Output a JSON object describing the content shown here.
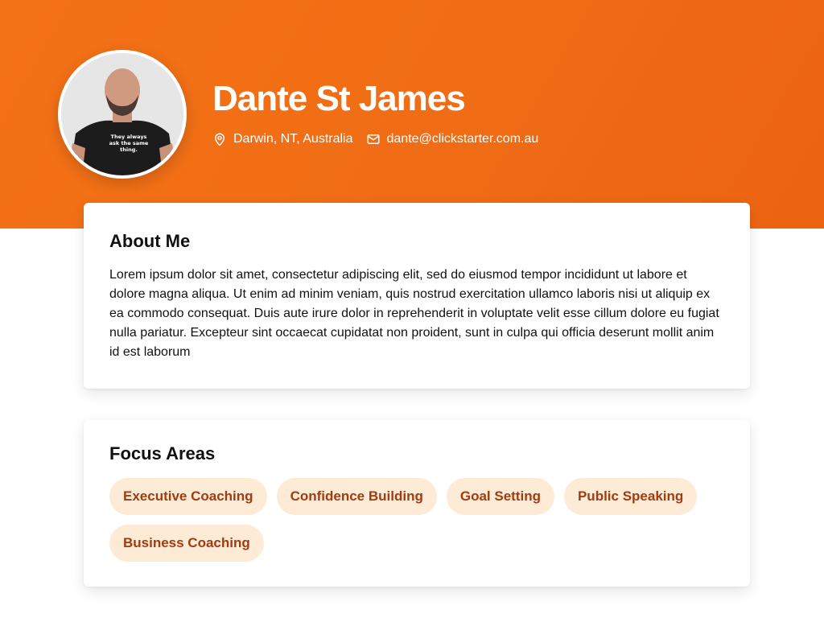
{
  "profile": {
    "name": "Dante St James",
    "location": "Darwin, NT, Australia",
    "email": "dante@clickstarter.com.au",
    "avatar_shirt_text": "They always ask the same thing.",
    "avatar_icon": "profile-photo"
  },
  "icons": {
    "location": "map-pin-icon",
    "email": "envelope-icon"
  },
  "about": {
    "title": "About Me",
    "text": "Lorem ipsum dolor sit amet, consectetur adipiscing elit, sed do eiusmod tempor incididunt ut labore et dolore magna aliqua. Ut enim ad minim veniam, quis nostrud exercitation ullamco laboris nisi ut aliquip ex ea commodo consequat. Duis aute irure dolor in reprehenderit in voluptate velit esse cillum dolore eu fugiat nulla pariatur. Excepteur sint occaecat cupidatat non proident, sunt in culpa qui officia deserunt mollit anim id est laborum"
  },
  "focus": {
    "title": "Focus Areas",
    "tags": [
      "Executive Coaching",
      "Confidence Building",
      "Goal Setting",
      "Public Speaking",
      "Business Coaching"
    ]
  },
  "colors": {
    "hero": "#f06d15",
    "tag_bg": "#feebd6",
    "tag_text": "#a13b12"
  }
}
